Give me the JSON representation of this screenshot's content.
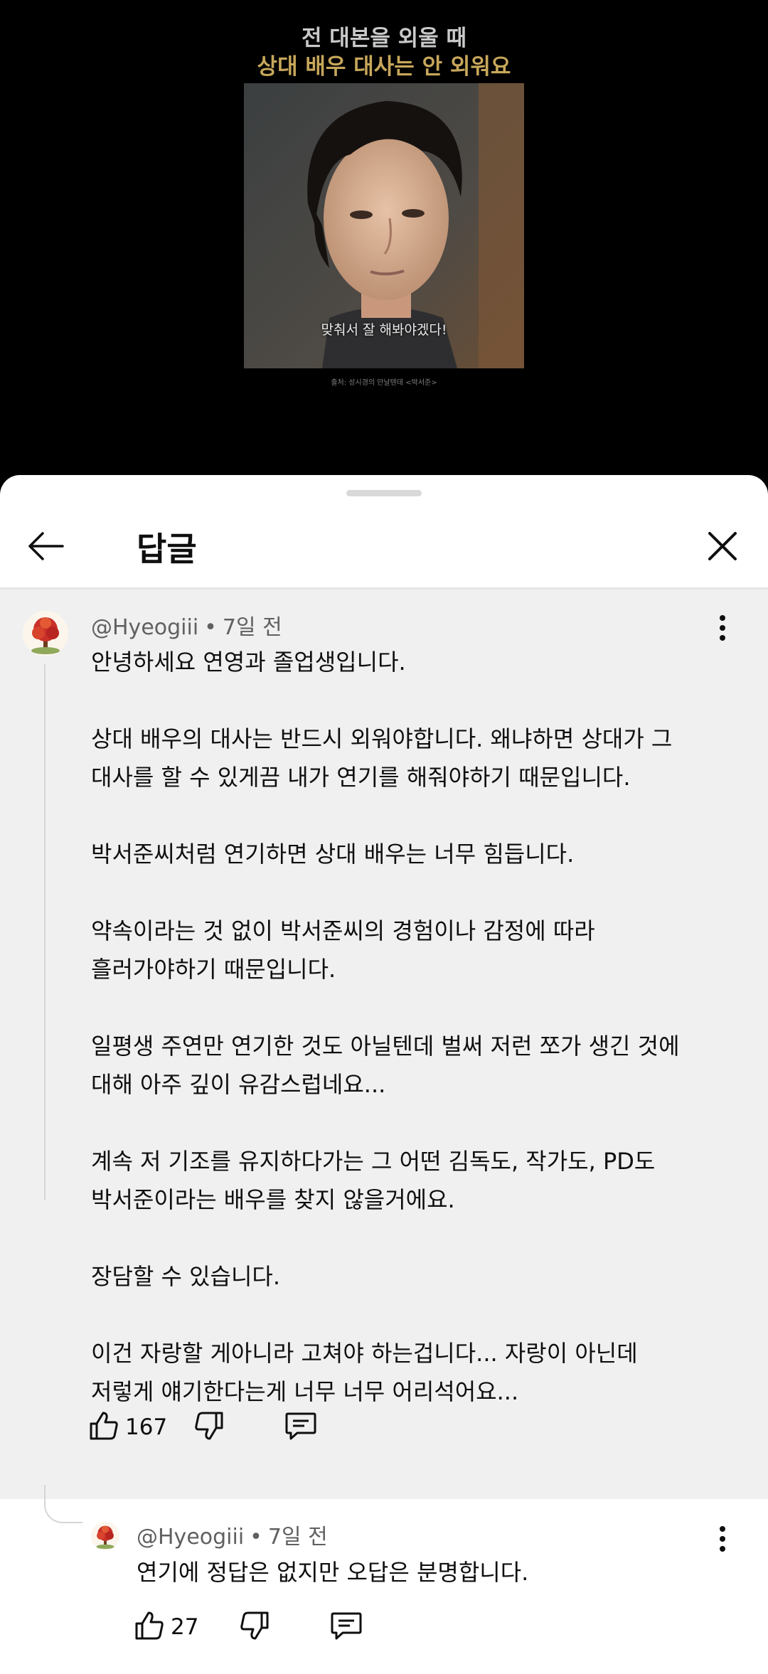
{
  "video": {
    "caption_line1": "전 대본을 외울 때",
    "caption_line2": "상대 배우 대사는 안 외워요",
    "subtitle": "맞춰서 잘 해봐야겠다!",
    "source": "출처: 성시경의 만날텐데 <박서준>"
  },
  "sheet": {
    "title": "답글",
    "back_icon": "arrow-left-icon",
    "close_icon": "close-icon"
  },
  "comment": {
    "author": "@Hyeogiii",
    "time": "7일 전",
    "text": "안녕하세요 연영과 졸업생입니다.\n\n상대 배우의 대사는 반드시 외워야합니다. 왜냐하면 상대가 그\n대사를 할 수 있게끔 내가 연기를 해줘야하기 때문입니다.\n\n박서준씨처럼 연기하면 상대 배우는 너무 힘듭니다.\n\n약속이라는 것 없이 박서준씨의 경험이나 감정에 따라\n흘러가야하기 때문입니다.\n\n일평생 주연만 연기한 것도 아닐텐데 벌써 저런 쪼가 생긴 것에\n대해 아주 깊이 유감스럽네요...\n\n계속 저 기조를 유지하다가는 그 어떤 김독도, 작가도, PD도\n박서준이라는 배우를 찾지 않을거에요.\n\n장담할 수 있습니다.\n\n이건 자랑할 게아니라 고쳐야 하는겁니다... 자랑이 아닌데\n저렇게 얘기한다는게 너무 너무 어리석어요...",
    "likes": "167"
  },
  "reply": {
    "author": "@Hyeogiii",
    "time": "7일 전",
    "text": "연기에 정답은 없지만 오답은 분명합니다.",
    "likes": "27"
  },
  "colors": {
    "sheet_bg": "#ffffff",
    "highlight_bg": "#f0f0f0",
    "caption_gold": "#c7a75a"
  }
}
